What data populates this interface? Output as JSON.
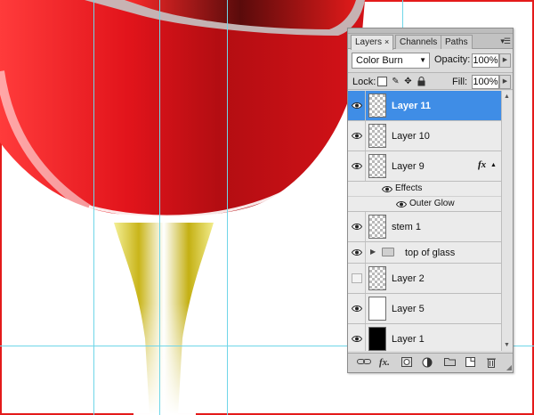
{
  "colors": {
    "wine_red": "#e0141b",
    "selection_blue": "#3f8de6",
    "guide_cyan": "#6fd6e8",
    "frame_red": "#e41b1b",
    "stem_yellow": "#d8c52a"
  },
  "layers_panel": {
    "tabs": [
      {
        "label": "Layers",
        "close": "×"
      },
      {
        "label": "Channels"
      },
      {
        "label": "Paths"
      }
    ],
    "menu_icon": "panel-menu-icon",
    "blend_mode": "Color Burn",
    "opacity_label": "Opacity:",
    "opacity_value": "100%",
    "lock_label": "Lock:",
    "fill_label": "Fill:",
    "fill_value": "100%",
    "layers": [
      {
        "name": "Layer 11",
        "visible": true,
        "selected": true,
        "thumb": "transparent"
      },
      {
        "name": "Layer 10",
        "visible": true,
        "thumb": "transparent"
      },
      {
        "name": "Layer 9",
        "visible": true,
        "thumb": "transparent",
        "fx": "fx"
      },
      {
        "name": "Effects"
      },
      {
        "name": "Outer Glow"
      },
      {
        "name": "stem 1",
        "visible": true,
        "thumb": "transparent"
      },
      {
        "name": "top of glass",
        "visible": true,
        "type": "group"
      },
      {
        "name": "Layer 2",
        "visible": false,
        "thumb": "transparent"
      },
      {
        "name": "Layer 5",
        "visible": true,
        "thumb": "white"
      },
      {
        "name": "Layer 1",
        "visible": true,
        "thumb": "black"
      }
    ],
    "bottom_icons": [
      "link-layers-icon",
      "fx-icon",
      "layer-mask-icon",
      "adjustment-layer-icon",
      "new-group-icon",
      "new-layer-icon",
      "trash-icon"
    ]
  }
}
